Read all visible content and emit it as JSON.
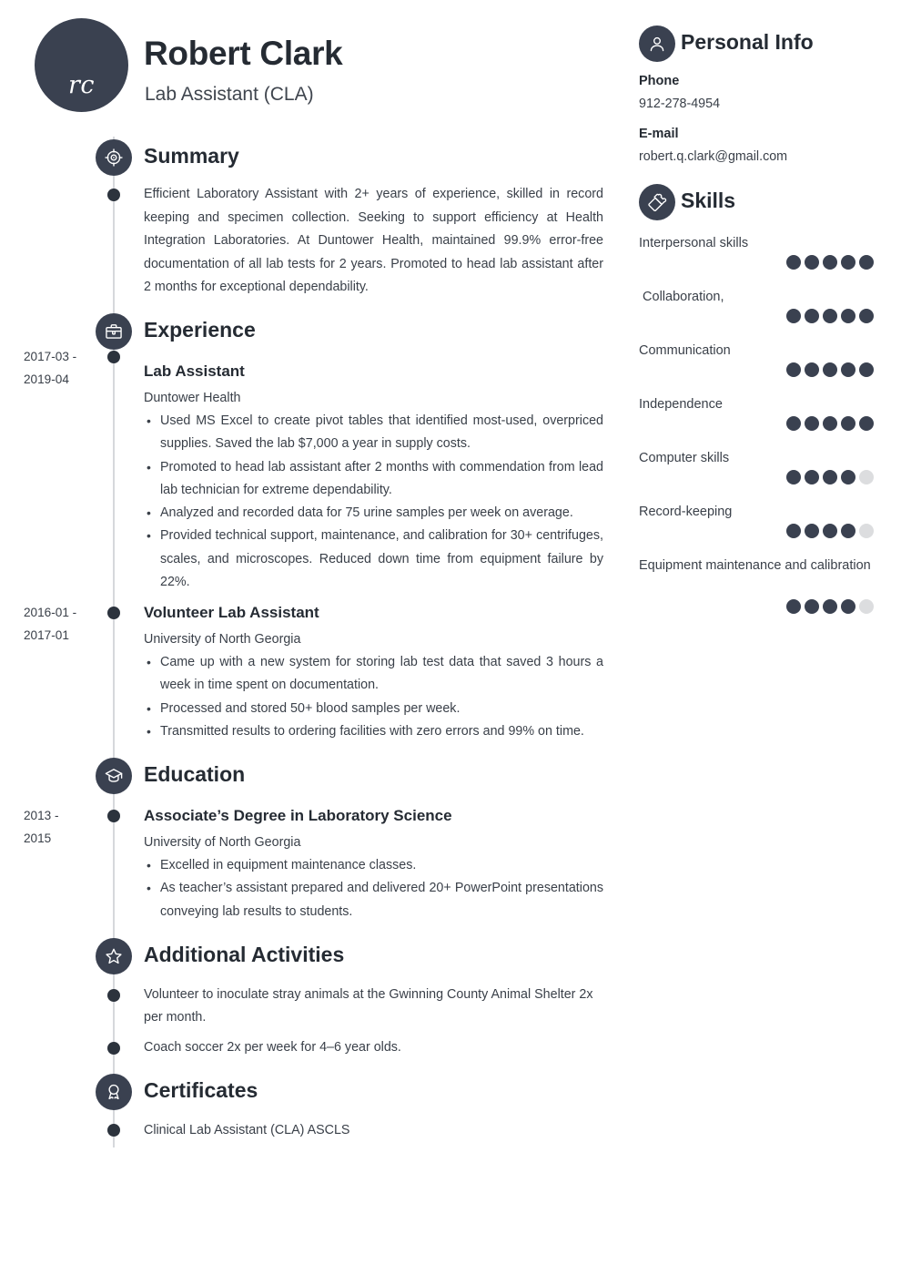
{
  "header": {
    "initials": "rc",
    "name": "Robert Clark",
    "job_title": "Lab Assistant (CLA)"
  },
  "theme": {
    "dark": "#3a4150",
    "text": "#3a4049",
    "heading": "#252b33",
    "rail": "#d6d8dc",
    "dot_off": "#dcdddf"
  },
  "sections": {
    "summary": {
      "title": "Summary",
      "icon": "target-icon",
      "text": "Efficient Laboratory Assistant with 2+ years of experience, skilled in record keeping and specimen collection. Seeking to support efficiency at Health Integration Laboratories. At Duntower Health, maintained 99.9% error-free documentation of all lab tests for 2 years. Promoted to head lab assistant after 2 months for exceptional dependability."
    },
    "experience": {
      "title": "Experience",
      "icon": "briefcase-icon",
      "entries": [
        {
          "date_line1": "2017-03 -",
          "date_line2": "2019-04",
          "title": "Lab Assistant",
          "org": "Duntower Health",
          "bullets": [
            "Used MS Excel to create pivot tables that identified most-used, overpriced supplies. Saved the lab $7,000 a year in supply costs.",
            "Promoted to head lab assistant after 2 months with commendation from lead lab technician for extreme dependability.",
            "Analyzed and recorded data for 75 urine samples per week on average.",
            "Provided technical support, maintenance, and calibration for 30+ centrifuges, scales, and microscopes. Reduced down time from equipment failure by 22%."
          ]
        },
        {
          "date_line1": "2016-01 -",
          "date_line2": "2017-01",
          "title": "Volunteer Lab Assistant",
          "org": "University of North Georgia",
          "bullets": [
            "Came up with a new system for storing lab test data that saved 3 hours a week in time spent on documentation.",
            "Processed and stored 50+ blood samples per week.",
            "Transmitted results to ordering facilities with zero errors and 99% on time."
          ]
        }
      ]
    },
    "education": {
      "title": "Education",
      "icon": "graduation-cap-icon",
      "entries": [
        {
          "date_line1": "2013 -",
          "date_line2": "2015",
          "title": "Associate’s Degree in Laboratory Science",
          "org": "University of North Georgia",
          "bullets": [
            "Excelled in equipment maintenance classes.",
            "As teacher’s assistant prepared and delivered 20+ PowerPoint presentations conveying lab results to students."
          ]
        }
      ]
    },
    "additional_activities": {
      "title": "Additional Activities",
      "icon": "star-icon",
      "items": [
        "Volunteer to inoculate stray animals at the Gwinning County Animal Shelter 2x per month.",
        "Coach soccer 2x per week for 4–6 year olds."
      ]
    },
    "certificates": {
      "title": "Certificates",
      "icon": "award-icon",
      "items": [
        "Clinical Lab Assistant (CLA) ASCLS"
      ]
    }
  },
  "sidebar": {
    "personal_info": {
      "title": "Personal Info",
      "icon": "person-icon",
      "fields": [
        {
          "label": "Phone",
          "value": "912-278-4954"
        },
        {
          "label": "E-mail",
          "value": "robert.q.clark@gmail.com"
        }
      ]
    },
    "skills": {
      "title": "Skills",
      "icon": "puzzle-icon",
      "max_rating": 5,
      "items": [
        {
          "name": "Interpersonal skills",
          "rating": 5
        },
        {
          "name": " Collaboration,",
          "rating": 5
        },
        {
          "name": "Communication",
          "rating": 5
        },
        {
          "name": "Independence",
          "rating": 5
        },
        {
          "name": "Computer skills",
          "rating": 4
        },
        {
          "name": "Record-keeping",
          "rating": 4
        },
        {
          "name": "Equipment maintenance and calibration",
          "rating": 4
        }
      ]
    }
  }
}
